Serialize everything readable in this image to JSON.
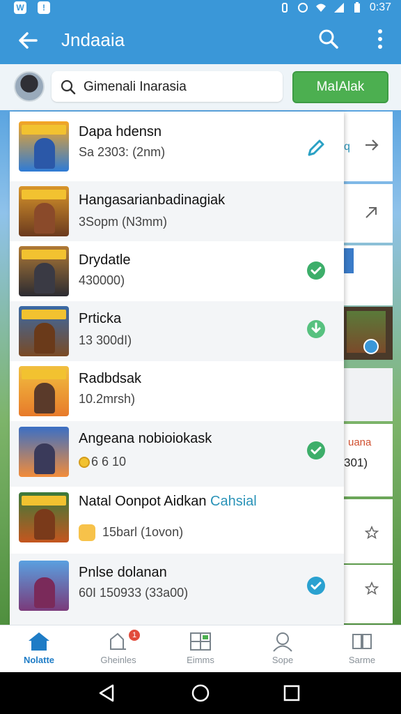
{
  "status_bar": {
    "time": "0:37"
  },
  "app_bar": {
    "title": "Jndaaia"
  },
  "toolbar": {
    "search_value": "Gimenali Inarasia",
    "action_label": "MaIAlak"
  },
  "list": [
    {
      "title": "Dapa hdensn",
      "subtitle": "Sa 2303: (2nm)",
      "status": "edit-icon"
    },
    {
      "title": "Hangasarianbadinagiak",
      "subtitle": "3Sopm (N3mm)",
      "status": ""
    },
    {
      "title": "Drydatle",
      "subtitle": "430000)",
      "status": "check-icon"
    },
    {
      "title": "Prticka",
      "subtitle": "13 300dI)",
      "status": "download-icon"
    },
    {
      "title": "Radbdsak",
      "subtitle": "10.2mrsh)",
      "status": ""
    },
    {
      "title": "Angeana nobioiokask",
      "subtitle": "6 6 10",
      "status": "check-icon"
    },
    {
      "title": "Natal Oonpot Aidkan",
      "title_accent": "Cahsial",
      "subtitle": "15barl (1ovon)",
      "status": ""
    },
    {
      "title": "Pnlse dolanan",
      "subtitle": "60I 150933 (33a00)",
      "status": "check-icon"
    }
  ],
  "back_cards": {
    "card1_text": "q",
    "card6_top": "uana",
    "card6_bottom": "301)"
  },
  "bottom_nav": [
    {
      "label": "Nolatte",
      "icon": "home-icon",
      "active": true
    },
    {
      "label": "Gheinles",
      "icon": "bookmark-icon",
      "badge": "1"
    },
    {
      "label": "Eimms",
      "icon": "grid-icon"
    },
    {
      "label": "Sope",
      "icon": "profile-icon"
    },
    {
      "label": "Sarme",
      "icon": "cards-icon"
    }
  ],
  "colors": {
    "brand": "#3a97d8",
    "action": "#4caf50",
    "check": "#3dae6a",
    "accent": "#2a93b8"
  }
}
